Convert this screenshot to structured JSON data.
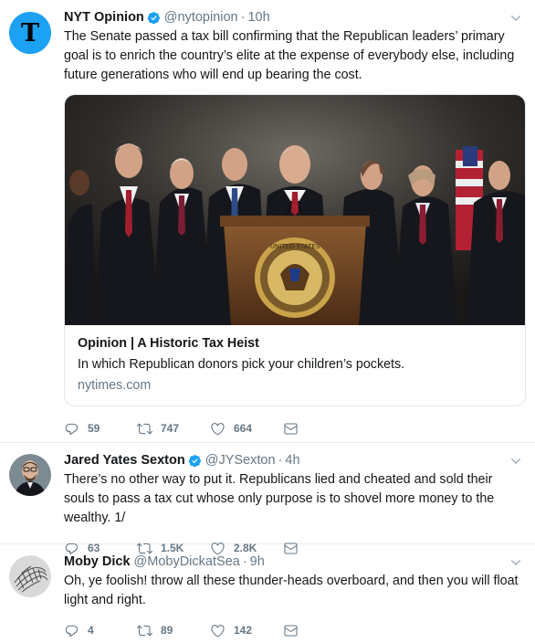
{
  "tweets": [
    {
      "name": "NYT Opinion",
      "handle": "@nytopinion",
      "dot": "·",
      "time": "10h",
      "text": "The Senate passed a tax bill confirming that the Republican leaders’ primary goal is to enrich the country’s elite at the expense of everybody else, including future generations who will end up bearing the cost.",
      "card": {
        "title": "Opinion | A Historic Tax Heist",
        "description": "In which Republican donors pick your children’s pockets.",
        "link": "nytimes.com",
        "seal_text": "UNITED STATES"
      },
      "replies": "59",
      "retweets": "747",
      "likes": "664",
      "avatar_icon": "nyt-logo-icon"
    },
    {
      "name": "Jared Yates Sexton",
      "handle": "@JYSexton",
      "dot": "·",
      "time": "4h",
      "text": "There’s no other way to put it. Republicans lied and cheated and sold their souls to pass a tax cut whose only purpose is to shovel more money to the wealthy. 1/",
      "replies": "63",
      "retweets": "1.5K",
      "likes": "2.8K"
    },
    {
      "name": "Moby Dick",
      "handle": "@MobyDickatSea",
      "dot": "·",
      "time": "9h",
      "text": "Oh, ye foolish! throw all these thunder-heads overboard, and then you will float light and right.",
      "replies": "4",
      "retweets": "89",
      "likes": "142"
    }
  ],
  "colors": {
    "accent": "#1da1f2",
    "muted": "#657786",
    "border": "#e6ecf0"
  }
}
